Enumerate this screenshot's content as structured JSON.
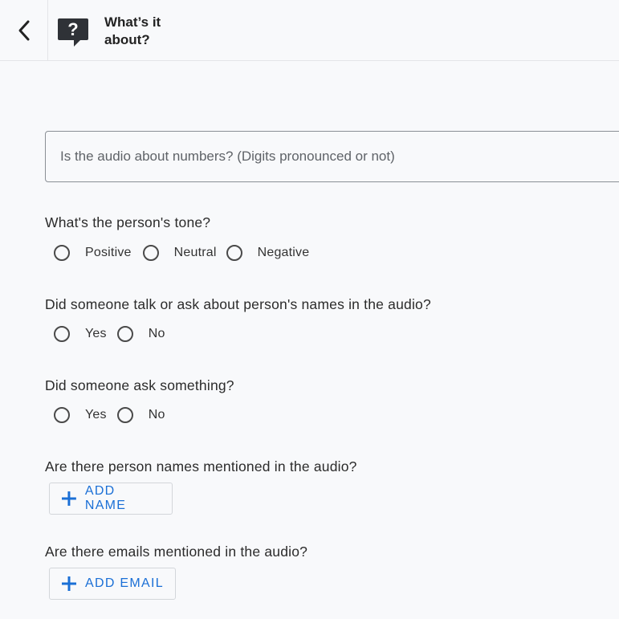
{
  "header": {
    "title": "What’s it about?",
    "back_icon": "chevron-left-icon",
    "help_icon": "question-bubble-icon"
  },
  "audio_question": {
    "placeholder": "Is the audio about numbers? (Digits pronounced or not)",
    "value": ""
  },
  "tone": {
    "question": "What's the person's tone?",
    "options": [
      "Positive",
      "Neutral",
      "Negative"
    ]
  },
  "names_talk": {
    "question": "Did someone talk or ask about person's names in the audio?",
    "options": [
      "Yes",
      "No"
    ]
  },
  "ask_something": {
    "question": "Did someone ask something?",
    "options": [
      "Yes",
      "No"
    ]
  },
  "person_names": {
    "question": "Are there person names mentioned in the audio?",
    "button_label": "ADD NAME"
  },
  "emails": {
    "question": "Are there emails mentioned in the audio?",
    "button_label": "ADD EMAIL"
  },
  "colors": {
    "accent": "#1a6fd6",
    "background": "#f8f9fb",
    "icon_dark": "#2f3237"
  }
}
